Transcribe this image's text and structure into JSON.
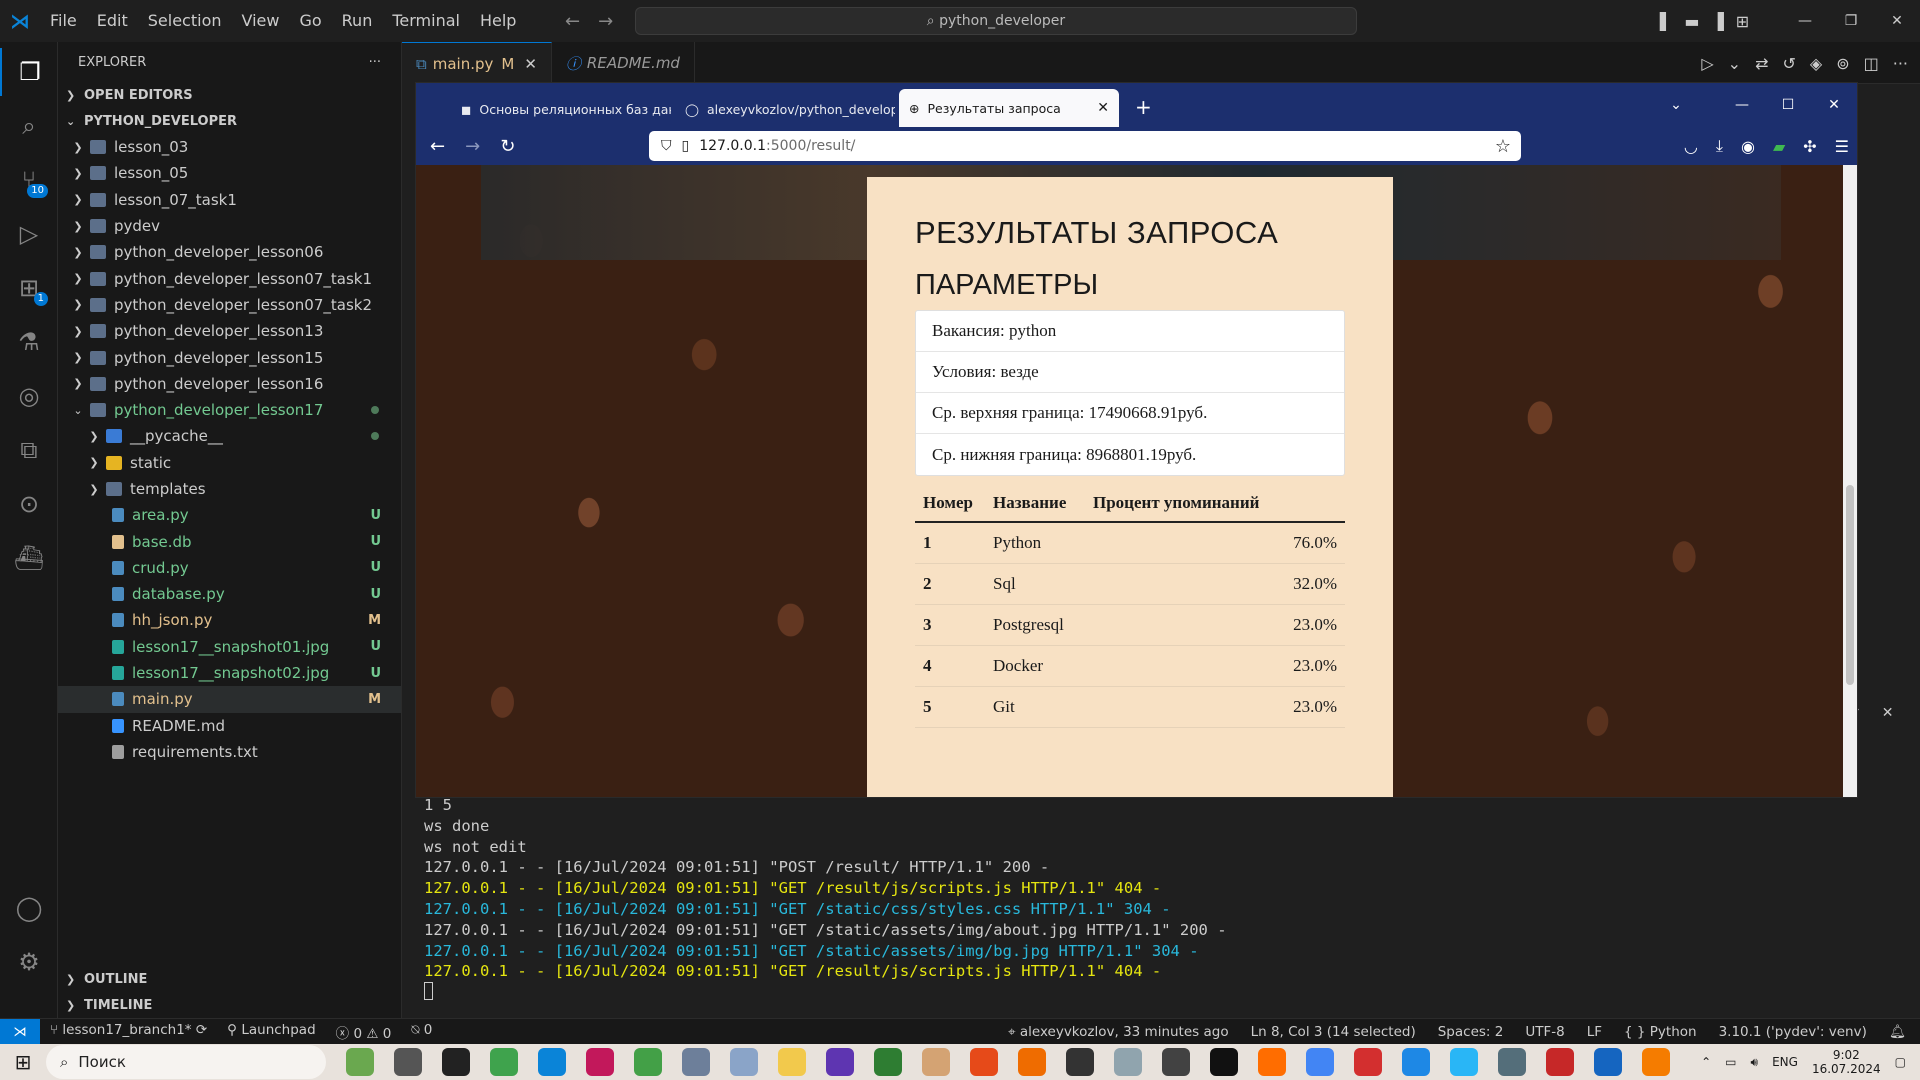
{
  "titlebar": {
    "menu": [
      "File",
      "Edit",
      "Selection",
      "View",
      "Go",
      "Run",
      "Terminal",
      "Help"
    ],
    "search_text": "python_developer"
  },
  "activity_badges": {
    "source_control": "10",
    "extensions": "1"
  },
  "sidebar": {
    "header": "EXPLORER",
    "open_editors": "OPEN EDITORS",
    "project": "PYTHON_DEVELOPER",
    "items": [
      {
        "label": "lesson_03",
        "type": "folder"
      },
      {
        "label": "lesson_05",
        "type": "folder"
      },
      {
        "label": "lesson_07_task1",
        "type": "folder"
      },
      {
        "label": "pydev",
        "type": "folder"
      },
      {
        "label": "python_developer_lesson06",
        "type": "folder"
      },
      {
        "label": "python_developer_lesson07_task1",
        "type": "folder"
      },
      {
        "label": "python_developer_lesson07_task2",
        "type": "folder"
      },
      {
        "label": "python_developer_lesson13",
        "type": "folder"
      },
      {
        "label": "python_developer_lesson15",
        "type": "folder"
      },
      {
        "label": "python_developer_lesson16",
        "type": "folder"
      },
      {
        "label": "python_developer_lesson17",
        "type": "folder-open"
      },
      {
        "label": "__pycache__",
        "type": "folder"
      },
      {
        "label": "static",
        "type": "folder"
      },
      {
        "label": "templates",
        "type": "folder"
      },
      {
        "label": "area.py",
        "status": "U"
      },
      {
        "label": "base.db",
        "status": "U"
      },
      {
        "label": "crud.py",
        "status": "U"
      },
      {
        "label": "database.py",
        "status": "U"
      },
      {
        "label": "hh_json.py",
        "status": "M"
      },
      {
        "label": "lesson17__snapshot01.jpg",
        "status": "U"
      },
      {
        "label": "lesson17__snapshot02.jpg",
        "status": "U"
      },
      {
        "label": "main.py",
        "status": "M"
      },
      {
        "label": "README.md",
        "status": ""
      },
      {
        "label": "requirements.txt",
        "status": ""
      }
    ],
    "outline": "OUTLINE",
    "timeline": "TIMELINE"
  },
  "editor_tabs": [
    {
      "label": "main.py",
      "badge": "M"
    },
    {
      "label": "README.md",
      "badge": ""
    }
  ],
  "browser": {
    "tabs": [
      "Основы реляционных баз дан",
      "alexeyvkozlov/python_develop",
      "Результаты запроса"
    ],
    "url_host": "127.0.0.1",
    "url_path": ":5000/result/"
  },
  "page": {
    "title": "РЕЗУЛЬТАТЫ ЗАПРОСА",
    "params_title": "ПАРАМЕТРЫ",
    "params": [
      "Вакансия: python",
      "Условия: везде",
      "Ср. верхняя граница: 17490668.91руб.",
      "Ср. нижняя граница: 8968801.19руб."
    ],
    "table_headers": [
      "Номер",
      "Название",
      "Процент упоминаний"
    ],
    "rows": [
      {
        "n": "1",
        "name": "Python",
        "pct": "76.0%"
      },
      {
        "n": "2",
        "name": "Sql",
        "pct": "32.0%"
      },
      {
        "n": "3",
        "name": "Postgresql",
        "pct": "23.0%"
      },
      {
        "n": "4",
        "name": "Docker",
        "pct": "23.0%"
      },
      {
        "n": "5",
        "name": "Git",
        "pct": "23.0%"
      }
    ]
  },
  "terminal": {
    "lines": [
      {
        "t": "1 5"
      },
      {
        "t": "ws done"
      },
      {
        "t": "ws not edit"
      },
      {
        "t": "127.0.0.1 - - [16/Jul/2024 09:01:51] \"POST /result/ HTTP/1.1\" 200 -"
      },
      {
        "t": "127.0.0.1 - - [16/Jul/2024 09:01:51] \"GET /result/js/scripts.js HTTP/1.1\" 404 -",
        "color": "y"
      },
      {
        "t": "127.0.0.1 - - [16/Jul/2024 09:01:51] \"GET /static/css/styles.css HTTP/1.1\" 304 -",
        "color": "c"
      },
      {
        "t": "127.0.0.1 - - [16/Jul/2024 09:01:51] \"GET /static/assets/img/about.jpg HTTP/1.1\" 200 -"
      },
      {
        "t": "127.0.0.1 - - [16/Jul/2024 09:01:51] \"GET /static/assets/img/bg.jpg HTTP/1.1\" 304 -",
        "color": "c"
      },
      {
        "t": "127.0.0.1 - - [16/Jul/2024 09:01:51] \"GET /result/js/scripts.js HTTP/1.1\" 404 -",
        "color": "y"
      }
    ]
  },
  "statusbar": {
    "branch": "lesson17_branch1*",
    "launchpad": "Launchpad",
    "problems": "0",
    "warnings": "0",
    "ports": "0",
    "blame": "alexeyvkozlov, 33 minutes ago",
    "position": "Ln 8, Col 3 (14 selected)",
    "spaces": "Spaces: 2",
    "encoding": "UTF-8",
    "eol": "LF",
    "language": "Python",
    "interpreter": "3.10.1 ('pydev': venv)"
  },
  "taskbar": {
    "search": "Поиск",
    "lang": "ENG",
    "time": "9:02",
    "date": "16.07.2024"
  }
}
